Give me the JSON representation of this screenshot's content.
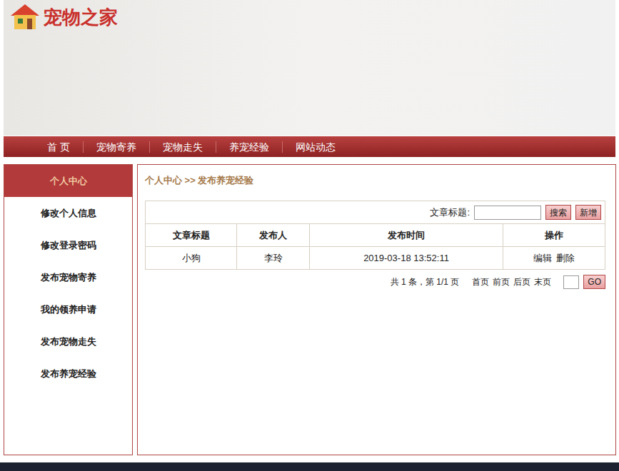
{
  "logo": "宠物之家",
  "nav": [
    {
      "label": "首 页",
      "selected": false
    },
    {
      "label": "宠物寄养",
      "selected": false
    },
    {
      "label": "宠物走失",
      "selected": false
    },
    {
      "label": "养宠经验",
      "selected": false
    },
    {
      "label": "网站动态",
      "selected": false
    }
  ],
  "sidebar": {
    "title": "个人中心",
    "items": [
      {
        "label": "修改个人信息",
        "selected": false
      },
      {
        "label": "修改登录密码",
        "selected": false
      },
      {
        "label": "发布宠物寄养",
        "selected": false
      },
      {
        "label": "我的领养申请",
        "selected": false
      },
      {
        "label": "发布宠物走失",
        "selected": false
      },
      {
        "label": "发布养宠经验",
        "selected": false
      }
    ]
  },
  "breadcrumb": "个人中心 >> 发布养宠经验",
  "search": {
    "label": "文章标题:",
    "value": "",
    "buttons": [
      "搜索",
      "新增"
    ]
  },
  "table": {
    "columns": [
      "文章标题",
      "发布人",
      "发布时间",
      "操作"
    ],
    "rows": [
      {
        "title": "小狗",
        "author": "李玲",
        "time": "2019-03-18 13:52:11",
        "actions": [
          "编辑",
          "删除"
        ]
      }
    ]
  },
  "pagination": {
    "summary": "共 1 条，第 1/1 页",
    "links": [
      "首页",
      "前页",
      "后页",
      "末页"
    ],
    "page_input": "",
    "go": "GO"
  }
}
